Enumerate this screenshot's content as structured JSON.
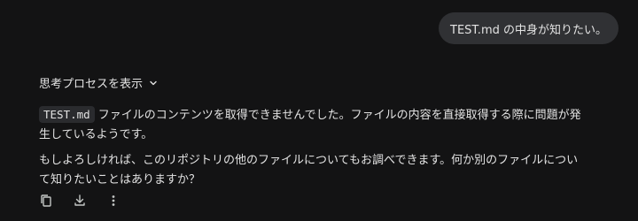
{
  "user_message": {
    "text": "TEST.md の中身が知りたい。"
  },
  "thinking": {
    "label": "思考プロセスを表示",
    "icon": "chevron-down-icon"
  },
  "response": {
    "paragraph1": {
      "code": "TEST.md",
      "text": "ファイルのコンテンツを取得できませんでした。ファイルの内容を直接取得する際に問題が発生しているようです。"
    },
    "paragraph2": "もしよろしければ、このリポジトリの他のファイルについてもお調べできます。何か別のファイルについて知りたいことはありますか？"
  },
  "actions": [
    {
      "icon": "copy-icon"
    },
    {
      "icon": "download-icon"
    },
    {
      "icon": "more-vertical-icon"
    }
  ],
  "colors": {
    "background": "#131314",
    "bubble": "#303134",
    "text": "#e3e3e3",
    "code_bg": "#2a2b2e"
  }
}
